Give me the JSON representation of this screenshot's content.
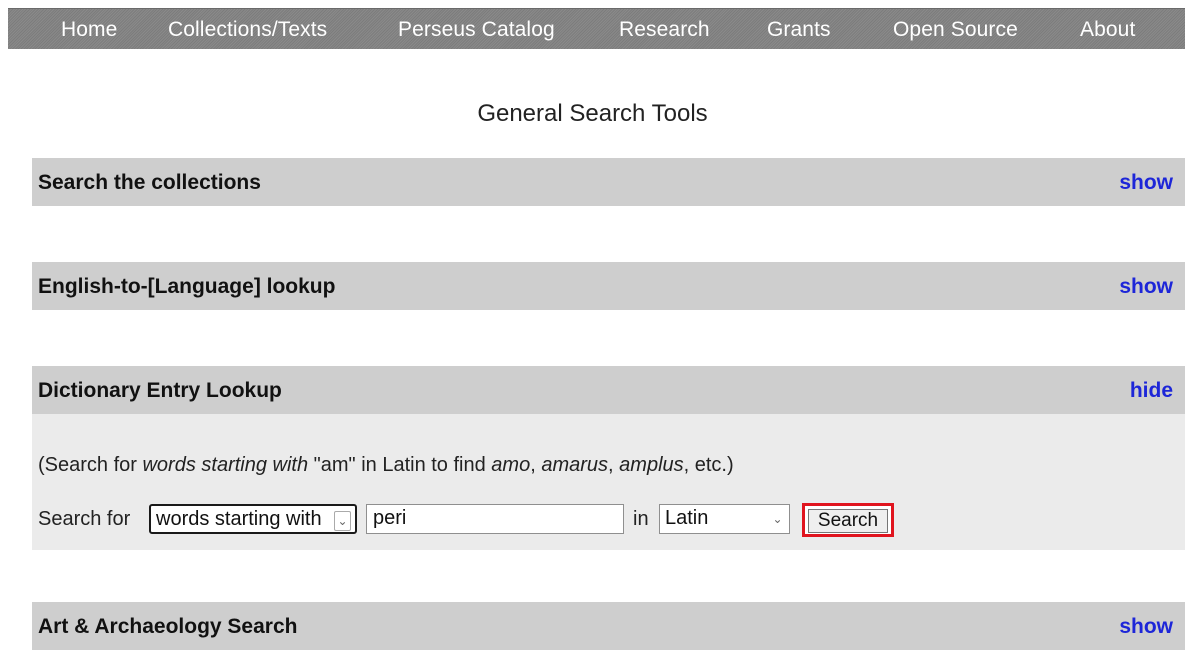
{
  "nav": {
    "items": [
      "Home",
      "Collections/Texts",
      "Perseus Catalog",
      "Research",
      "Grants",
      "Open Source",
      "About"
    ]
  },
  "page": {
    "title": "General Search Tools"
  },
  "sections": [
    {
      "title": "Search the collections",
      "toggle": "show"
    },
    {
      "title": "English-to-[Language] lookup",
      "toggle": "show"
    },
    {
      "title": "Dictionary Entry Lookup",
      "toggle": "hide"
    },
    {
      "title": "Art & Archaeology Search",
      "toggle": "show"
    }
  ],
  "dictionary": {
    "hint": {
      "part1": "(Search for ",
      "em1": "words starting with",
      "part2": " \"am\" in Latin to find ",
      "em2": "amo",
      "sep1": ", ",
      "em3": "amarus",
      "sep2": ", ",
      "em4": "amplus",
      "part3": ", etc.)"
    },
    "search_for_label": "Search for",
    "mode_value": "words starting with",
    "query_value": "peri",
    "in_label": "in",
    "language_value": "Latin",
    "search_button": "Search"
  },
  "colors": {
    "nav_bg": "#7f7f7f",
    "section_bar": "#cecece",
    "panel_bg": "#ebebeb",
    "toggle_link": "#1d26d8",
    "highlight": "#e0141e"
  },
  "icons": {
    "select_arrow": "chevron-down-icon"
  }
}
